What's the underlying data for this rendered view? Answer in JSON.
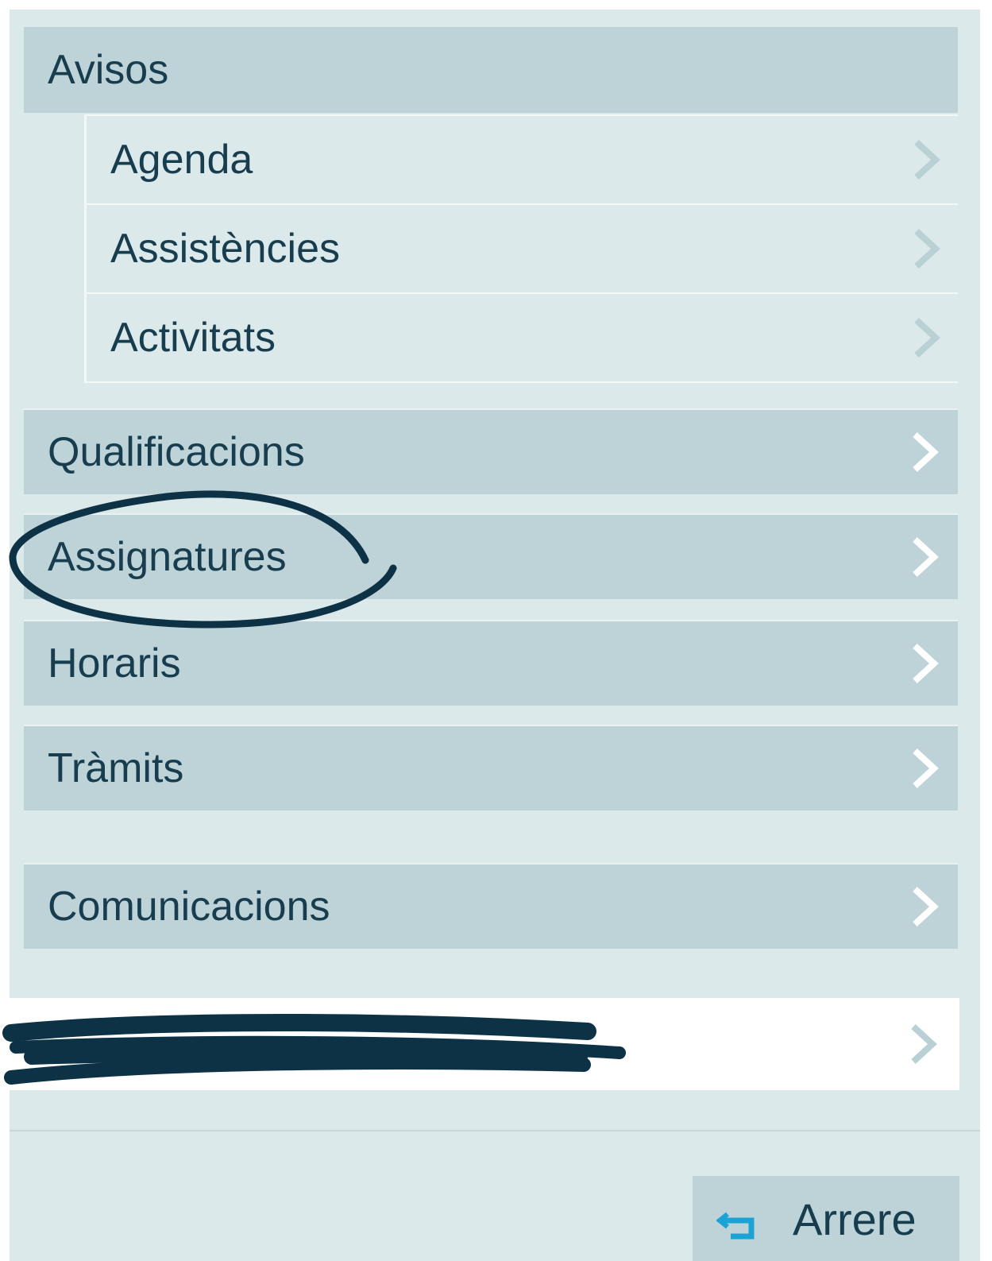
{
  "menu": {
    "avisos": {
      "label": "Avisos"
    },
    "sub_items": [
      {
        "label": "Agenda"
      },
      {
        "label": "Assistències"
      },
      {
        "label": "Activitats"
      }
    ],
    "items": [
      {
        "label": "Qualificacions"
      },
      {
        "label": "Assignatures"
      },
      {
        "label": "Horaris"
      },
      {
        "label": "Tràmits"
      },
      {
        "label": "Comunicacions"
      }
    ]
  },
  "footer": {
    "back_label": "Arrere"
  },
  "colors": {
    "panel_bg": "#dce9ea",
    "row_bg": "#bdd3d7",
    "text": "#173d4f",
    "chevron_on_dark": "#ffffff",
    "chevron_on_light": "#b9d0d4",
    "accent_icon": "#1ba3d6",
    "scribble": "#0d3246"
  },
  "icons": {
    "chevron": "chevron-right-icon",
    "back": "return-arrow-icon"
  }
}
